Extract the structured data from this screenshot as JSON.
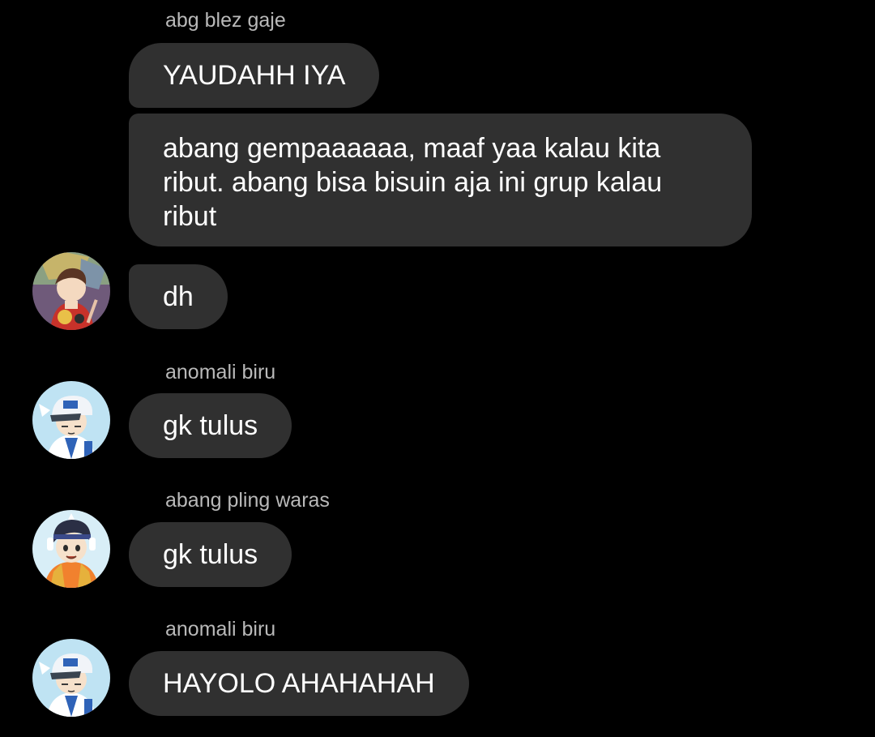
{
  "messages": [
    {
      "sender": "abg blez gaje",
      "texts": [
        "YAUDAHH IYA",
        "abang gempaaaaaa, maaf yaa kalau kita ribut. abang bisa bisuin aja ini grup kalau ribut"
      ]
    },
    {
      "sender": "",
      "texts": [
        "dh"
      ]
    },
    {
      "sender": "anomali biru",
      "texts": [
        "gk tulus"
      ]
    },
    {
      "sender": "abang pling waras",
      "texts": [
        "gk tulus"
      ]
    },
    {
      "sender": "anomali biru",
      "texts": [
        "HAYOLO AHAHAHAH"
      ]
    }
  ],
  "avatars": {
    "abg_blez_gaje": "anime-boy-red-jacket-avatar",
    "anomali_biru": "anime-boy-blue-cap-avatar",
    "abang_pling_waras": "anime-boy-orange-shirt-avatar"
  },
  "colors": {
    "background": "#000000",
    "bubble": "#303030",
    "sender_name": "#b9b9b9",
    "message_text": "#ffffff"
  }
}
